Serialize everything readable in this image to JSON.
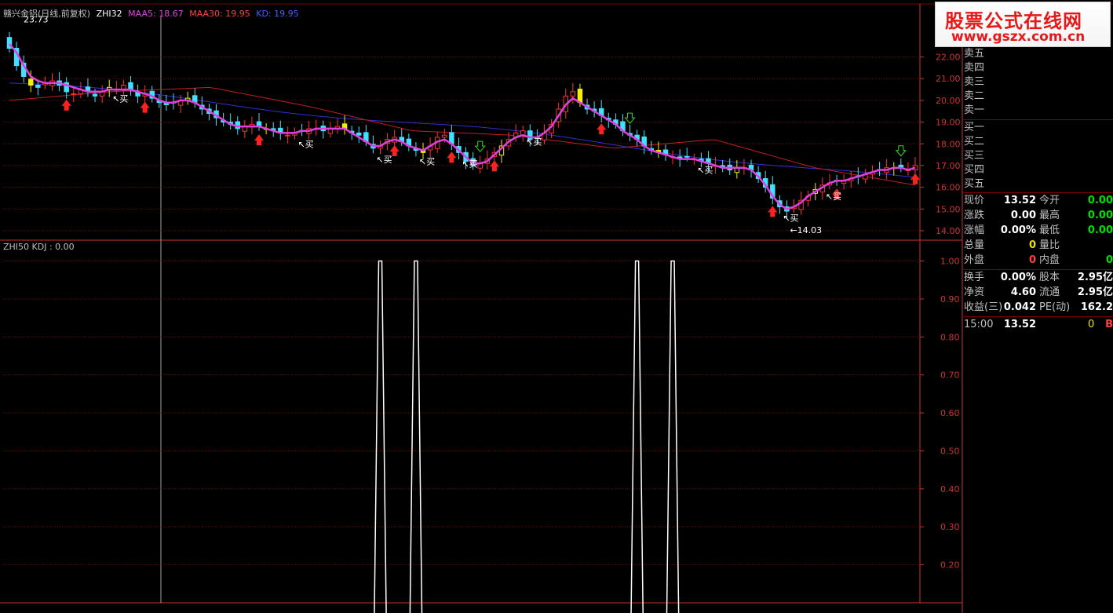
{
  "header": {
    "stock": "赣兴金铝(日线,前复权)",
    "indicator": "ZHI32",
    "ma5_label": "MAA5: 18.67",
    "ma30_label": "MAA30: 19.95",
    "kd_label": "KD: 19.95"
  },
  "lower_legend": "ZHI50 KDJ : 0.00",
  "brand": {
    "name": "股票公式在线网",
    "url": "www.gszx.com.cn"
  },
  "chart_data": [
    {
      "type": "candlestick",
      "title": "赣兴金铝(日线,前复权)",
      "ylim": [
        13.6,
        23.9
      ],
      "yticks": [
        "22.00",
        "21.00",
        "20.00",
        "19.00",
        "18.00",
        "17.00",
        "16.00",
        "15.00",
        "14.00"
      ],
      "annotations": {
        "high": "23.73",
        "low": "14.03",
        "buy_label": "买"
      },
      "close": [
        22.4,
        21.6,
        21.1,
        20.7,
        20.6,
        20.8,
        20.9,
        20.7,
        20.4,
        20.3,
        20.5,
        20.4,
        20.2,
        20.4,
        20.6,
        20.5,
        20.7,
        20.5,
        20.2,
        20.3,
        20.1,
        19.9,
        19.8,
        19.9,
        20.0,
        20.1,
        19.9,
        19.6,
        19.4,
        19.2,
        19.0,
        18.9,
        18.7,
        18.8,
        18.9,
        18.8,
        18.7,
        18.6,
        18.5,
        18.4,
        18.5,
        18.6,
        18.7,
        18.7,
        18.6,
        18.7,
        18.8,
        18.7,
        18.5,
        18.4,
        18.1,
        17.8,
        17.9,
        18.2,
        18.3,
        18.1,
        17.9,
        17.7,
        17.6,
        17.9,
        18.3,
        18.4,
        18.0,
        17.6,
        17.2,
        17.0,
        17.1,
        17.3,
        17.6,
        17.9,
        18.2,
        18.5,
        18.6,
        18.2,
        18.3,
        18.5,
        18.9,
        19.6,
        20.2,
        20.4,
        19.9,
        19.6,
        19.5,
        19.3,
        19.1,
        18.9,
        18.6,
        18.4,
        18.2,
        17.9,
        17.7,
        17.6,
        17.5,
        17.4,
        17.3,
        17.4,
        17.3,
        17.2,
        17.1,
        17.0,
        16.9,
        16.8,
        16.9,
        16.9,
        16.8,
        16.4,
        16.0,
        15.5,
        15.1,
        14.9,
        15.1,
        15.4,
        15.6,
        15.9,
        16.1,
        16.2,
        16.3,
        16.3,
        16.4,
        16.5,
        16.6,
        16.7,
        16.8,
        16.9,
        16.9,
        16.9,
        16.8,
        17.0
      ],
      "ma5": [
        22.6,
        22.2,
        21.6,
        21.1,
        20.9,
        20.8,
        20.8,
        20.8,
        20.7,
        20.6,
        20.5,
        20.4,
        20.4,
        20.4,
        20.5,
        20.5,
        20.5,
        20.5,
        20.4,
        20.3,
        20.2,
        20.0,
        19.9,
        19.9,
        20.0,
        20.0,
        19.9,
        19.7,
        19.5,
        19.3,
        19.1,
        18.9,
        18.8,
        18.8,
        18.8,
        18.8,
        18.7,
        18.6,
        18.5,
        18.5,
        18.5,
        18.6,
        18.6,
        18.7,
        18.7,
        18.7,
        18.7,
        18.7,
        18.5,
        18.3,
        18.1,
        17.9,
        17.9,
        18.1,
        18.2,
        18.1,
        17.9,
        17.8,
        17.7,
        17.9,
        18.1,
        18.2,
        18.0,
        17.7,
        17.4,
        17.1,
        17.1,
        17.2,
        17.5,
        17.8,
        18.1,
        18.3,
        18.4,
        18.3,
        18.3,
        18.5,
        18.8,
        19.3,
        19.8,
        20.1,
        19.9,
        19.7,
        19.5,
        19.3,
        19.1,
        18.9,
        18.6,
        18.4,
        18.2,
        17.9,
        17.7,
        17.6,
        17.5,
        17.4,
        17.3,
        17.3,
        17.3,
        17.2,
        17.1,
        17.0,
        16.9,
        16.9,
        16.9,
        16.9,
        16.8,
        16.5,
        16.1,
        15.6,
        15.2,
        15.0,
        15.1,
        15.3,
        15.6,
        15.8,
        16.0,
        16.2,
        16.3,
        16.3,
        16.4,
        16.5,
        16.6,
        16.7,
        16.8,
        16.8,
        16.9,
        16.9,
        16.8,
        16.9
      ],
      "ma30_start": 20.8,
      "ma30_mid": 18.9,
      "ma30_end": 16.3,
      "red_line": [
        20.0,
        20.4,
        20.6,
        19.7,
        18.6,
        18.4,
        17.8,
        18.2,
        16.9,
        16.1
      ]
    },
    {
      "type": "line",
      "title": "ZHI50 KDJ",
      "ylim": [
        0.1,
        1.03
      ],
      "yticks": [
        "1.00",
        "0.90",
        "0.80",
        "0.70",
        "0.60",
        "0.50",
        "0.40",
        "0.30",
        "0.20"
      ],
      "spikes_at_candle_index": [
        52,
        57,
        88,
        93
      ],
      "spike_value": 1.0,
      "base_value": 0.0
    }
  ],
  "order_book": {
    "sell": [
      "卖五",
      "卖四",
      "卖三",
      "卖二",
      "卖一"
    ],
    "buy": [
      "买一",
      "买二",
      "买三",
      "买四",
      "买五"
    ]
  },
  "quote": [
    {
      "l": "现价",
      "v": "13.52",
      "vc": "#ffffff",
      "l2": "今开",
      "v2": "0.00",
      "v2c": "#00e000"
    },
    {
      "l": "涨跌",
      "v": "0.00",
      "vc": "#ffffff",
      "l2": "最高",
      "v2": "0.00",
      "v2c": "#00e000"
    },
    {
      "l": "涨幅",
      "v": "0.00%",
      "vc": "#ffffff",
      "l2": "最低",
      "v2": "0.00",
      "v2c": "#00e000"
    },
    {
      "l": "总量",
      "v": "0",
      "vc": "#f0e000",
      "l2": "量比",
      "v2": "",
      "v2c": "#ffffff"
    },
    {
      "l": "外盘",
      "v": "0",
      "vc": "#ff4040",
      "l2": "内盘",
      "v2": "0",
      "v2c": "#00e000"
    },
    {
      "l": "换手",
      "v": "0.00%",
      "vc": "#ffffff",
      "l2": "股本",
      "v2": "2.95亿",
      "v2c": "#ffffff"
    },
    {
      "l": "净资",
      "v": "4.60",
      "vc": "#ffffff",
      "l2": "流通",
      "v2": "2.95亿",
      "v2c": "#ffffff"
    },
    {
      "l": "收益(三)",
      "v": "0.042",
      "vc": "#ffffff",
      "l2": "PE(动)",
      "v2": "162.2",
      "v2c": "#ffffff"
    },
    {
      "l": "15:00",
      "v": "13.52",
      "vc": "#ffffff",
      "l2": "0",
      "v2": "B",
      "v2c": "#ff4040"
    }
  ],
  "colors": {
    "up": "#ff3030",
    "down": "#40e0ff",
    "ma5": "#e040e0",
    "ma30": "#3030d0",
    "red_line": "#c02020",
    "grid": "#800000",
    "axis": "#d03030"
  }
}
